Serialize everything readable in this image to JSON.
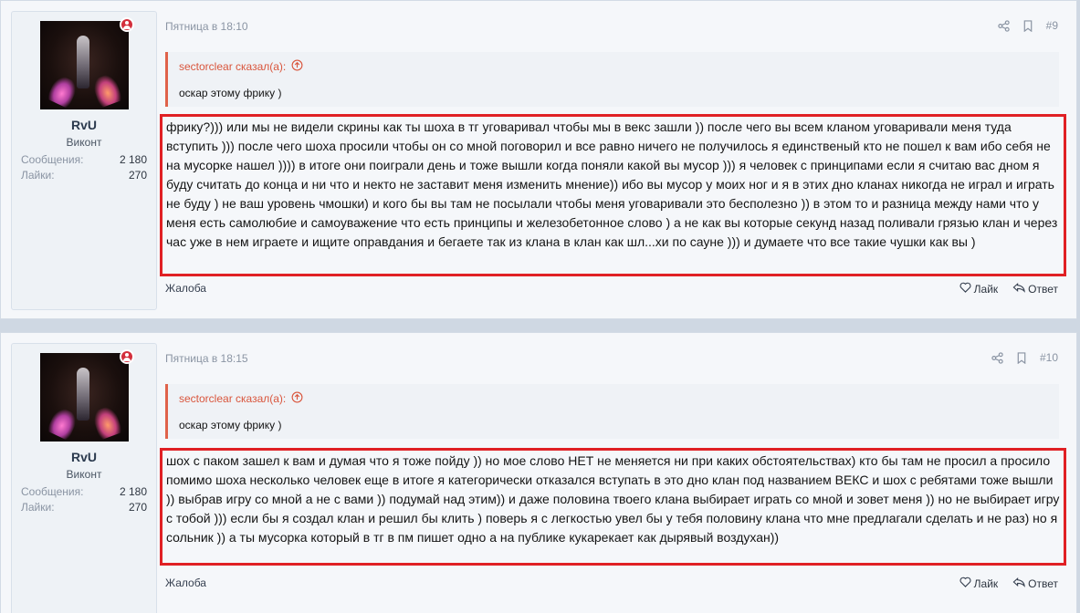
{
  "posts": [
    {
      "user": {
        "name": "RvU",
        "title": "Виконт",
        "messages_label": "Сообщения:",
        "messages_value": "2 180",
        "likes_label": "Лайки:",
        "likes_value": "270"
      },
      "time": "Пятница в 18:10",
      "number": "#9",
      "quote": {
        "author": "sectorclear сказал(а):",
        "text": "оскар этому фрику )"
      },
      "message": "фрику?))) или мы не видели скрины как ты шоха в тг уговаривал чтобы мы в векс зашли )) после чего вы всем кланом уговаривали меня туда вступить ))) после чего шоха просили чтобы он со мной поговорил и все равно ничего не получилось я единственый кто не пошел к вам ибо себя не на мусорке нашел )))) в итоге они поиграли день и тоже вышли когда поняли какой вы мусор ))) я человек с принципами если я считаю вас дном я буду считать до конца и ни что и некто не заставит меня изменить мнение)) ибо вы мусор у моих ног и я в этих дно кланах никогда не играл и играть не буду ) не ваш уровень чмошки) и кого бы вы там не посылали чтобы меня уговаривали это бесполезно )) в этом то и разница между нами что у меня есть самолюбие и самоуважение что есть принципы и железобетонное слово ) а не как вы которые секунд назад поливали грязью клан и через час уже в нем играете и ищите оправдания и бегаете так из клана в клан как шл...хи по сауне ))) и думаете что все такие чушки как вы )",
      "report": "Жалоба",
      "like": "Лайк",
      "reply": "Ответ"
    },
    {
      "user": {
        "name": "RvU",
        "title": "Виконт",
        "messages_label": "Сообщения:",
        "messages_value": "2 180",
        "likes_label": "Лайки:",
        "likes_value": "270"
      },
      "time": "Пятница в 18:15",
      "number": "#10",
      "quote": {
        "author": "sectorclear сказал(а):",
        "text": "оскар этому фрику )"
      },
      "message": "шох с паком зашел к вам и думая что я тоже пойду )) но мое слово НЕТ не меняется ни при каких обстоятельствах) кто бы там не просил а просило помимо шоха несколько человек еще в итоге я категорически отказался вступать в это дно клан под названием ВЕКС и шох с ребятами тоже вышли )) выбрав игру со мной а не с вами )) подумай над этим)) и даже половина твоего клана выбирает играть со мной и зовет меня )) но не выбирает игру с тобой ))) если бы я создал клан и решил бы клить ) поверь я с легкостью увел бы у тебя половину клана что мне предлагали сделать и не раз) но я сольник )) а ты мусорка который в тг в пм пишет одно а на публике кукарекает как дырявый воздухан))",
      "report": "Жалоба",
      "like": "Лайк",
      "reply": "Ответ"
    }
  ],
  "colors": {
    "highlight_border": "#e02024",
    "quote_accent": "#e0624a",
    "status_dot": "#d32f3c"
  },
  "icons": [
    "share-icon",
    "bookmark-icon",
    "arrow-up-circle-icon",
    "heart-icon",
    "reply-icon",
    "user-status-icon"
  ]
}
